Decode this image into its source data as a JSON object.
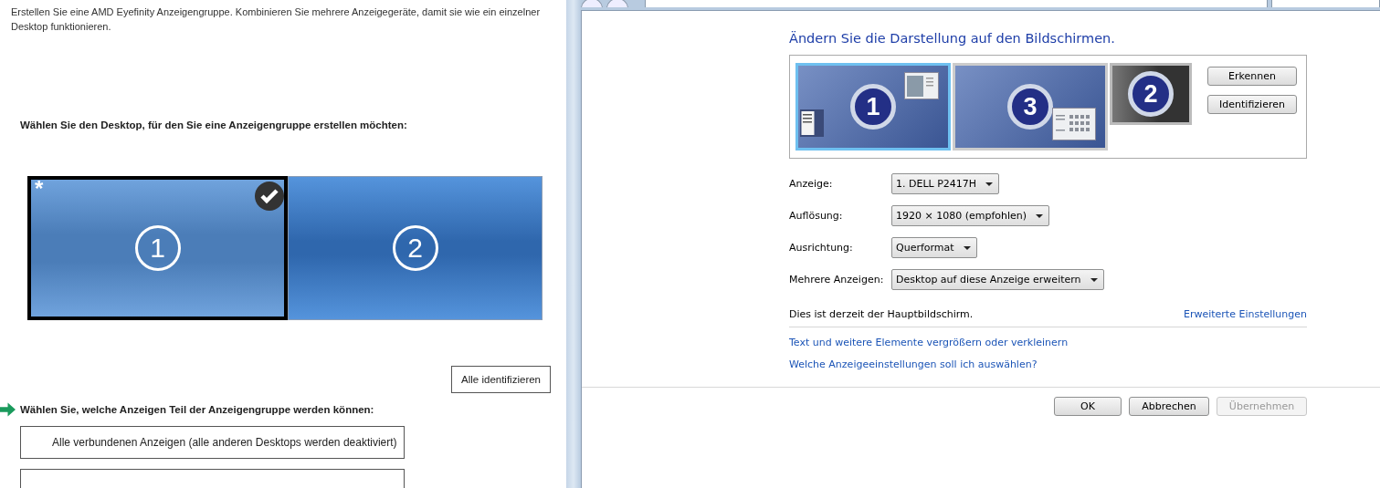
{
  "left": {
    "intro": "Erstellen Sie eine AMD Eyefinity Anzeigengruppe. Kombinieren Sie mehrere Anzeigegeräte, damit sie wie ein einzelner Desktop funktionieren.",
    "desktop_heading": "Wählen Sie den Desktop, für den Sie eine Anzeigengruppe erstellen möchten:",
    "desktops": [
      {
        "number": "1",
        "marker": "*",
        "selected": true
      },
      {
        "number": "2",
        "selected": false
      }
    ],
    "identify_all_button": "Alle identifizieren",
    "displays_heading": "Wählen Sie, welche Anzeigen Teil der Anzeigengruppe werden können:",
    "display_options": [
      "Alle verbundenen Anzeigen (alle anderen Desktops werden deaktiviert)"
    ]
  },
  "right": {
    "title": "Ändern Sie die Darstellung auf den Bildschirmen.",
    "monitors": [
      {
        "number": "1",
        "selected": true,
        "active": true,
        "kind": "start"
      },
      {
        "number": "3",
        "selected": false,
        "active": true,
        "kind": "grid"
      },
      {
        "number": "2",
        "selected": false,
        "active": false,
        "kind": "plain"
      }
    ],
    "monitor_buttons": [
      "Erkennen",
      "Identifizieren"
    ],
    "fields": [
      {
        "label": "Anzeige:",
        "value": "1. DELL P2417H"
      },
      {
        "label": "Auflösung:",
        "value": "1920 × 1080 (empfohlen)"
      },
      {
        "label": "Ausrichtung:",
        "value": "Querformat"
      },
      {
        "label": "Mehrere Anzeigen:",
        "value": "Desktop auf diese Anzeige erweitern"
      }
    ],
    "status": "Dies ist derzeit der Hauptbildschirm.",
    "advanced_link": "Erweiterte Einstellungen",
    "links": [
      "Text und weitere Elemente vergrößern oder verkleinern",
      "Welche Anzeigeeinstellungen soll ich auswählen?"
    ],
    "dialog_buttons": [
      {
        "label": "OK",
        "disabled": false
      },
      {
        "label": "Abbrechen",
        "disabled": false
      },
      {
        "label": "Übernehmen",
        "disabled": true
      }
    ]
  }
}
